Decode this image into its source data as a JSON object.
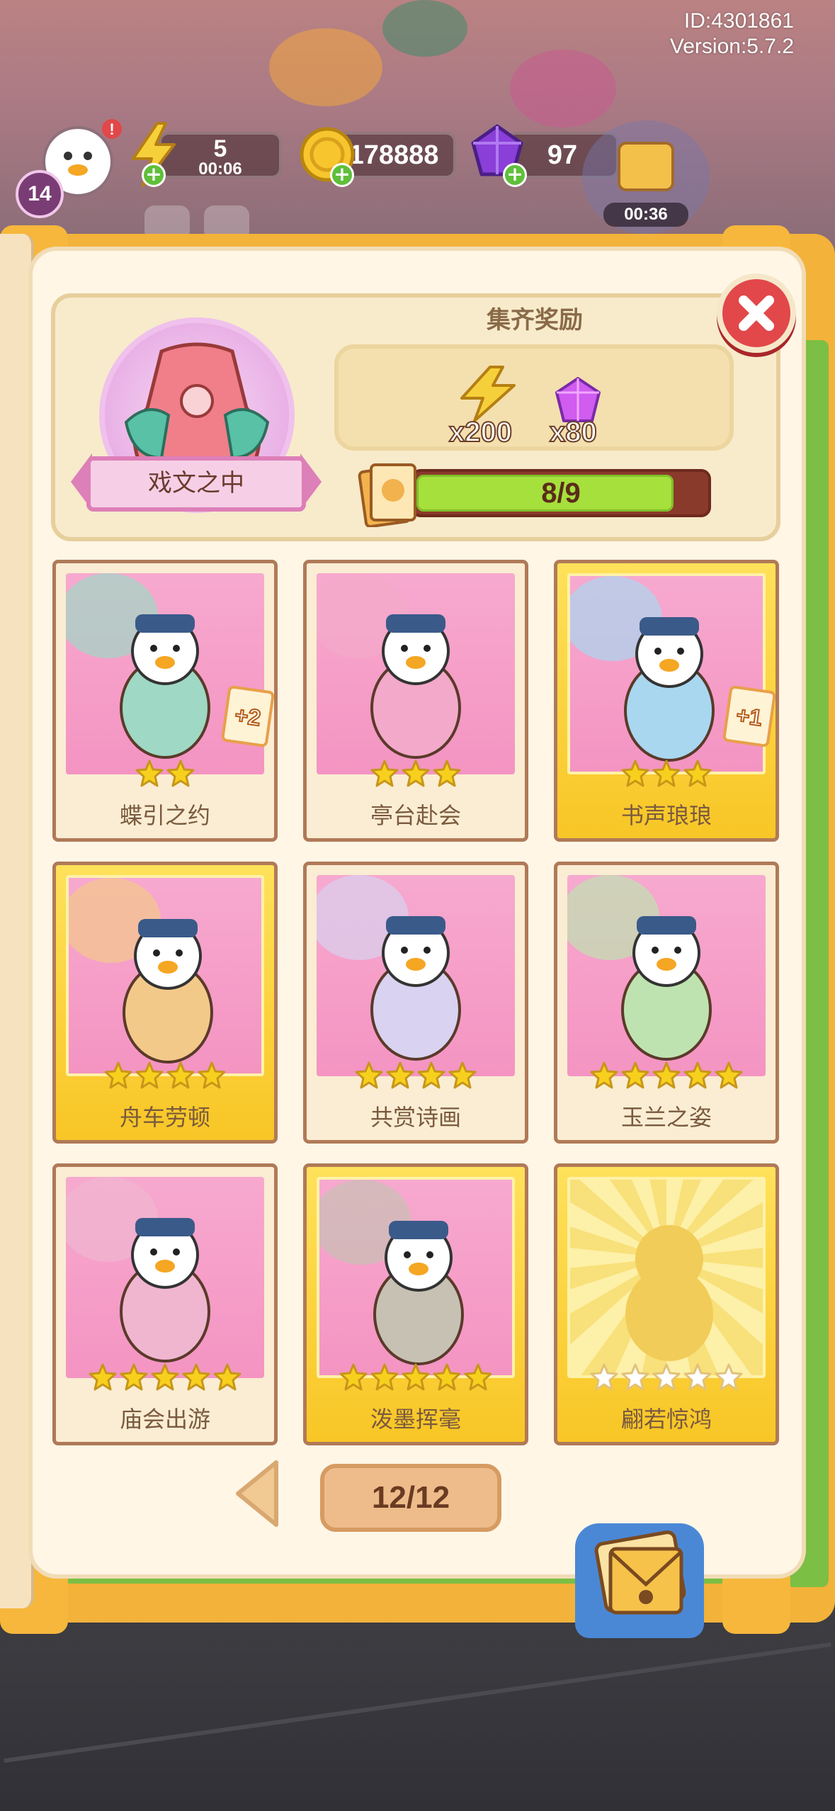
{
  "system": {
    "id_text": "ID:4301861",
    "version_text": "Version:5.7.2"
  },
  "hud": {
    "level": "14",
    "energy": {
      "value": "5",
      "timer": "00:06",
      "icon": "lightning-icon"
    },
    "coins": {
      "value": "178888",
      "icon": "coin-icon"
    },
    "gems": {
      "value": "97",
      "icon": "gem-icon"
    },
    "event_timer": "00:36"
  },
  "collection": {
    "name": "戏文之中",
    "reward_title": "集齐奖励",
    "rewards": [
      {
        "icon": "lightning-icon",
        "amount": "x200"
      },
      {
        "icon": "gem-icon",
        "amount": "x80"
      }
    ],
    "progress_text": "8/9",
    "progress": {
      "collected": 8,
      "total": 9
    }
  },
  "cards": [
    {
      "name": "蝶引之约",
      "stars": 2,
      "gold": false,
      "unlocked": true,
      "badge": "+2"
    },
    {
      "name": "亭台赴会",
      "stars": 3,
      "gold": false,
      "unlocked": true,
      "badge": ""
    },
    {
      "name": "书声琅琅",
      "stars": 3,
      "gold": true,
      "unlocked": true,
      "badge": "+1"
    },
    {
      "name": "舟车劳顿",
      "stars": 4,
      "gold": true,
      "unlocked": true,
      "badge": ""
    },
    {
      "name": "共赏诗画",
      "stars": 4,
      "gold": false,
      "unlocked": true,
      "badge": ""
    },
    {
      "name": "玉兰之姿",
      "stars": 5,
      "gold": false,
      "unlocked": true,
      "badge": ""
    },
    {
      "name": "庙会出游",
      "stars": 5,
      "gold": false,
      "unlocked": true,
      "badge": ""
    },
    {
      "name": "泼墨挥毫",
      "stars": 5,
      "gold": true,
      "unlocked": true,
      "badge": ""
    },
    {
      "name": "翩若惊鸿",
      "stars": 5,
      "gold": true,
      "unlocked": false,
      "badge": ""
    }
  ],
  "pager": {
    "text": "12/12"
  },
  "colors": {
    "panel_bg": "#fff6e6",
    "card_pink": "#f494c2",
    "card_gold": "#f8c626",
    "progress_fill": "#a6e03c",
    "close_red": "#e2474a"
  }
}
